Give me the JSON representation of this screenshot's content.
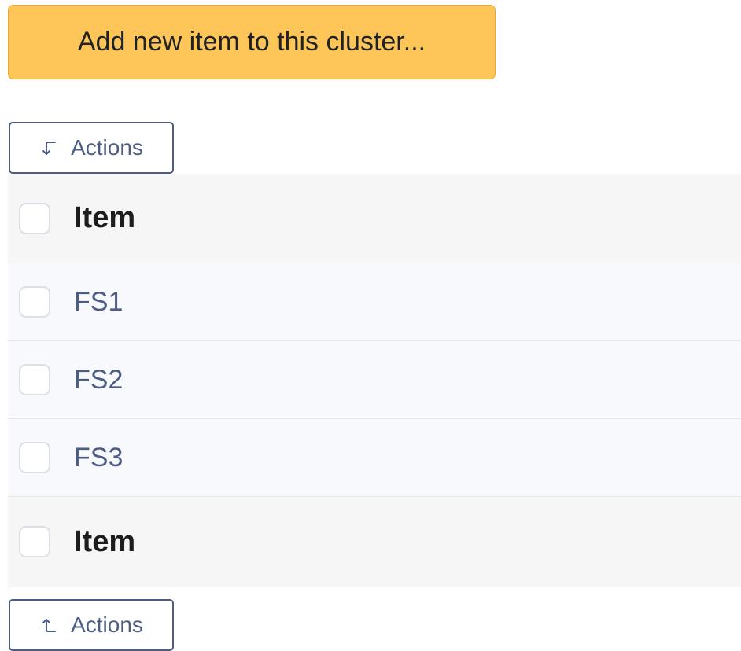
{
  "add_button": {
    "label": "Add new item to this cluster..."
  },
  "actions_top": {
    "label": "Actions",
    "icon": "corner-down-left-icon"
  },
  "actions_bottom": {
    "label": "Actions",
    "icon": "corner-up-left-icon"
  },
  "table": {
    "header_label": "Item",
    "footer_label": "Item",
    "rows": [
      {
        "label": "FS1"
      },
      {
        "label": "FS2"
      },
      {
        "label": "FS3"
      }
    ]
  },
  "colors": {
    "accent": "#fec659",
    "link": "#4d5c84"
  }
}
